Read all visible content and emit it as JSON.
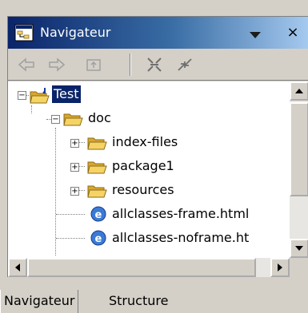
{
  "view": {
    "title": "Navigateur",
    "menu_icon": "chevron-down-icon",
    "close_label": "×"
  },
  "toolbar": {
    "buttons": [
      {
        "name": "back-icon"
      },
      {
        "name": "forward-icon"
      },
      {
        "name": "up-icon"
      },
      {
        "name": "collapse-all-icon"
      },
      {
        "name": "link-with-editor-icon"
      }
    ]
  },
  "tree": {
    "nodes": [
      {
        "label": "Test",
        "type": "project",
        "expanded": true,
        "selected": true
      },
      {
        "label": "doc",
        "type": "folder",
        "expanded": true
      },
      {
        "label": "index-files",
        "type": "folder",
        "expanded": false
      },
      {
        "label": "package1",
        "type": "folder",
        "expanded": false
      },
      {
        "label": "resources",
        "type": "folder",
        "expanded": false
      },
      {
        "label": "allclasses-frame.html",
        "type": "html-file"
      },
      {
        "label": "allclasses-noframe.ht",
        "type": "html-file"
      }
    ]
  },
  "tabs": [
    {
      "label": "Navigateur",
      "active": true
    },
    {
      "label": "Structure",
      "active": false
    }
  ],
  "colors": {
    "title_start": "#0a246a",
    "title_end": "#a6caf0",
    "selection": "#0a246a",
    "folder": "#f6d365"
  }
}
